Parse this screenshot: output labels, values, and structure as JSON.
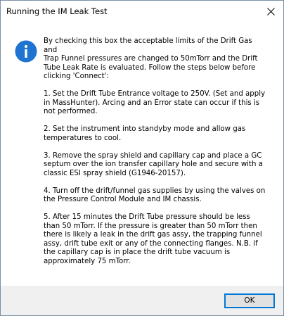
{
  "window": {
    "title": "Running the IM Leak Test",
    "close_icon": "close-icon"
  },
  "message": {
    "icon": "info-icon",
    "paragraphs": [
      "By checking this box the acceptable limits of the Drift Gas and\nTrap Funnel pressures are changed to 50mTorr and the Drift\nTube Leak Rate is evaluated. Follow the steps below before\nclicking 'Connect':",
      "1. Set the Drift Tube Entrance voltage to 250V. (Set and apply\nin MassHunter). Arcing and an Error state can occur if this is\nnot performed.",
      "2. Set the instrument into standyby mode and allow gas\ntemperatures to cool.",
      "3. Remove the spray shield and capillary cap and place a GC\nseptum over the ion transfer capillary hole and secure with a\nclassic ESI spray shield (G1946-20157).",
      "4. Turn off the drift/funnel gas supplies by using the valves on\nthe Pressure Control Module and IM chassis.",
      "5. After 15 minutes the Drift Tube pressure should be less\nthan 50 mTorr. If the pressure is greater than 50 mTorr then\nthere is likely a leak in the drift gas assy, the trapping funnel\nassy, drift tube exit or any of the connecting flanges. N.B. if\nthe capillary cap is in place the drift tube vacuum is\napproximately 75 mTorr."
    ]
  },
  "buttons": {
    "ok_label": "OK"
  },
  "colors": {
    "info_icon": "#1e74d0",
    "footer_bg": "#f0f0f0",
    "focus_border": "#0078d7"
  }
}
